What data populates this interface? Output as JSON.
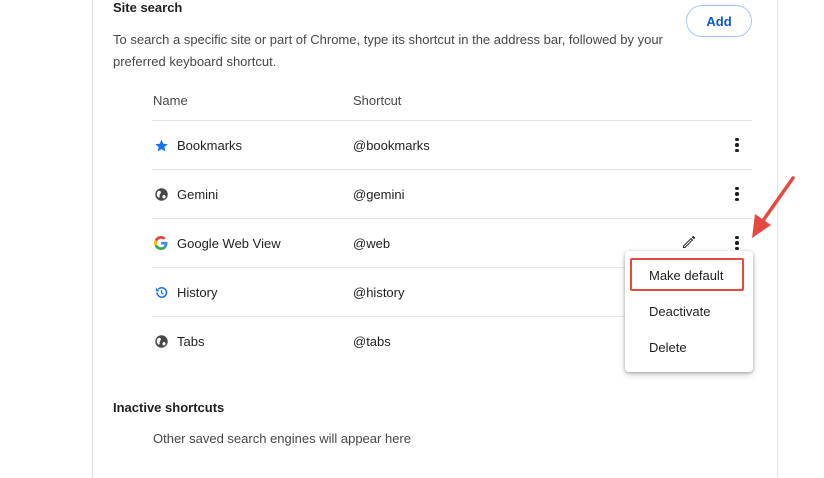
{
  "site_search": {
    "title": "Site search",
    "description": "To search a specific site or part of Chrome, type its shortcut in the address bar, followed by your preferred keyboard shortcut.",
    "add_label": "Add",
    "columns": {
      "name": "Name",
      "shortcut": "Shortcut"
    },
    "rows": [
      {
        "name": "Bookmarks",
        "shortcut": "@bookmarks",
        "icon": "star-icon"
      },
      {
        "name": "Gemini",
        "shortcut": "@gemini",
        "icon": "globe-icon"
      },
      {
        "name": "Google Web View",
        "shortcut": "@web",
        "icon": "google-g-icon"
      },
      {
        "name": "History",
        "shortcut": "@history",
        "icon": "history-icon"
      },
      {
        "name": "Tabs",
        "shortcut": "@tabs",
        "icon": "globe-icon"
      }
    ]
  },
  "context_menu": {
    "items": [
      "Make default",
      "Deactivate",
      "Delete"
    ]
  },
  "inactive": {
    "title": "Inactive shortcuts",
    "empty_text": "Other saved search engines will appear here"
  },
  "colors": {
    "accent": "#0b57d0",
    "star": "#1a73e8",
    "annotation": "#e5483f"
  }
}
